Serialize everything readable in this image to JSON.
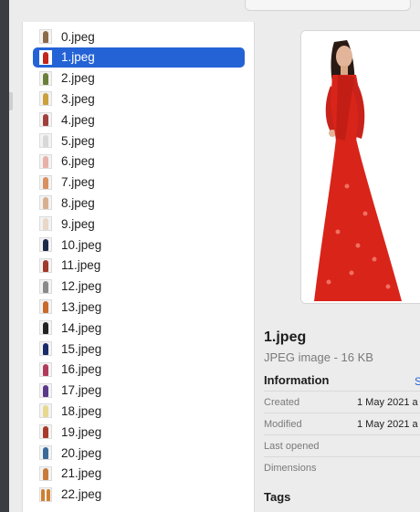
{
  "files": [
    {
      "name": "0.jpeg",
      "color": "#8a6a4a",
      "selected": false
    },
    {
      "name": "1.jpeg",
      "color": "#c4261b",
      "selected": true
    },
    {
      "name": "2.jpeg",
      "color": "#6b7f3a",
      "selected": false
    },
    {
      "name": "3.jpeg",
      "color": "#c9a03a",
      "selected": false
    },
    {
      "name": "4.jpeg",
      "color": "#a0403a",
      "selected": false
    },
    {
      "name": "5.jpeg",
      "color": "#d8d8d8",
      "selected": false
    },
    {
      "name": "6.jpeg",
      "color": "#e8b0a8",
      "selected": false
    },
    {
      "name": "7.jpeg",
      "color": "#d89060",
      "selected": false
    },
    {
      "name": "8.jpeg",
      "color": "#d8b090",
      "selected": false
    },
    {
      "name": "9.jpeg",
      "color": "#e8d8c8",
      "selected": false
    },
    {
      "name": "10.jpeg",
      "color": "#1c2a4a",
      "selected": false
    },
    {
      "name": "11.jpeg",
      "color": "#a03a2a",
      "selected": false
    },
    {
      "name": "12.jpeg",
      "color": "#8a8a8a",
      "selected": false
    },
    {
      "name": "13.jpeg",
      "color": "#c86a2a",
      "selected": false
    },
    {
      "name": "14.jpeg",
      "color": "#222222",
      "selected": false
    },
    {
      "name": "15.jpeg",
      "color": "#1a2a6a",
      "selected": false
    },
    {
      "name": "16.jpeg",
      "color": "#b03a5a",
      "selected": false
    },
    {
      "name": "17.jpeg",
      "color": "#5a3a8a",
      "selected": false
    },
    {
      "name": "18.jpeg",
      "color": "#e8d890",
      "selected": false
    },
    {
      "name": "19.jpeg",
      "color": "#a83a2a",
      "selected": false
    },
    {
      "name": "20.jpeg",
      "color": "#3a6a9a",
      "selected": false
    },
    {
      "name": "21.jpeg",
      "color": "#c87a3a",
      "selected": false
    },
    {
      "name": "22.jpeg",
      "color": "#d08030",
      "selected": false,
      "double": true
    }
  ],
  "preview": {
    "file_name": "1.jpeg",
    "file_kind": "JPEG image - 16 KB",
    "information_label": "Information",
    "show_more_label": "S",
    "rows": [
      {
        "key": "Created",
        "value": "1 May 2021 a"
      },
      {
        "key": "Modified",
        "value": "1 May 2021 a"
      },
      {
        "key": "Last opened",
        "value": ""
      },
      {
        "key": "Dimensions",
        "value": ""
      }
    ],
    "tags_label": "Tags",
    "saree_color": "#d9241a"
  }
}
